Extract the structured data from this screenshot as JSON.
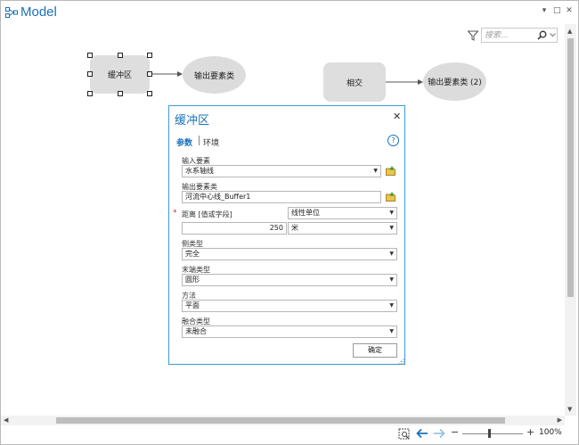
{
  "window": {
    "title": "Model",
    "controls": [
      "▾",
      "□",
      "✕"
    ]
  },
  "search": {
    "placeholder": "搜索..."
  },
  "nodes": {
    "buffer": "缓冲区",
    "output1": "输出要素类",
    "intersect": "相交",
    "output2": "输出要素类 (2)"
  },
  "status": {
    "zoom": "100%"
  },
  "dialog": {
    "title": "缓冲区",
    "tabs": {
      "params": "参数",
      "env": "环境"
    },
    "input_features": {
      "label": "输入要素",
      "value": "水系轴线"
    },
    "output_features": {
      "label": "输出要素类",
      "value": "河流中心线_Buffer1"
    },
    "distance": {
      "label": "距离 [值或字段]",
      "mode": "线性单位",
      "value": "250",
      "unit": "米"
    },
    "side_type": {
      "label": "侧类型",
      "value": "完全"
    },
    "end_type": {
      "label": "末端类型",
      "value": "圆形"
    },
    "method": {
      "label": "方法",
      "value": "平面"
    },
    "dissolve_type": {
      "label": "融合类型",
      "value": "未融合"
    },
    "ok_label": "确定"
  },
  "colors": {
    "accent": "#1a72bb",
    "node_fill": "#dedede",
    "dialog_border": "#3d9ad9",
    "required": "#d02b2b"
  }
}
